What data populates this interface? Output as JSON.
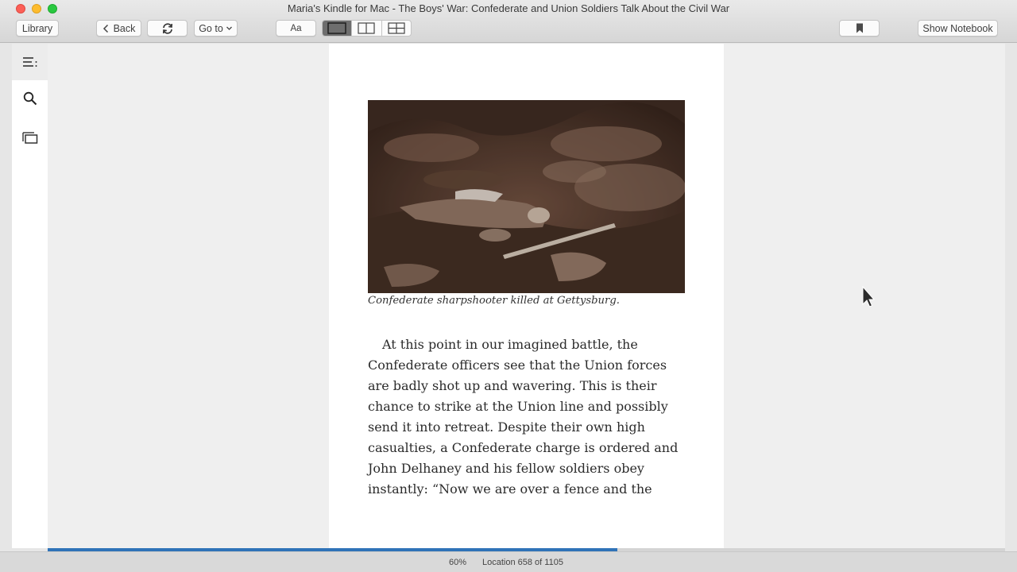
{
  "window": {
    "title": "Maria's Kindle for Mac - The Boys' War: Confederate and Union Soldiers Talk About the Civil War"
  },
  "toolbar": {
    "library_label": "Library",
    "back_label": "Back",
    "goto_label": "Go to",
    "font_label": "Aa",
    "notebook_label": "Show Notebook",
    "view_modes": [
      "single-page",
      "two-column",
      "multi-column"
    ],
    "active_view": "single-page"
  },
  "sidebar": {
    "items": [
      {
        "icon": "table-of-contents-icon",
        "active": true
      },
      {
        "icon": "search-icon",
        "active": false
      },
      {
        "icon": "flashcards-icon",
        "active": false
      }
    ]
  },
  "page": {
    "caption": "Confederate sharpshooter killed at Gettysburg.",
    "lines": [
      "At this point in our imagined battle, the",
      "Confederate officers see that the Union forces",
      "are badly shot up and wavering. This is their",
      "chance to strike at the Union line and possibly",
      "send it into retreat. Despite their own high",
      "casualties, a Confederate charge is ordered and",
      "John Delhaney and his fellow soldiers obey",
      "instantly: “Now we are over a fence and the"
    ]
  },
  "status": {
    "percent_label": "60%",
    "location_label": "Location 658 of 1105",
    "progress_fraction": 0.595
  },
  "colors": {
    "progress": "#2f73b8",
    "photo_tone": "#4a3429"
  }
}
